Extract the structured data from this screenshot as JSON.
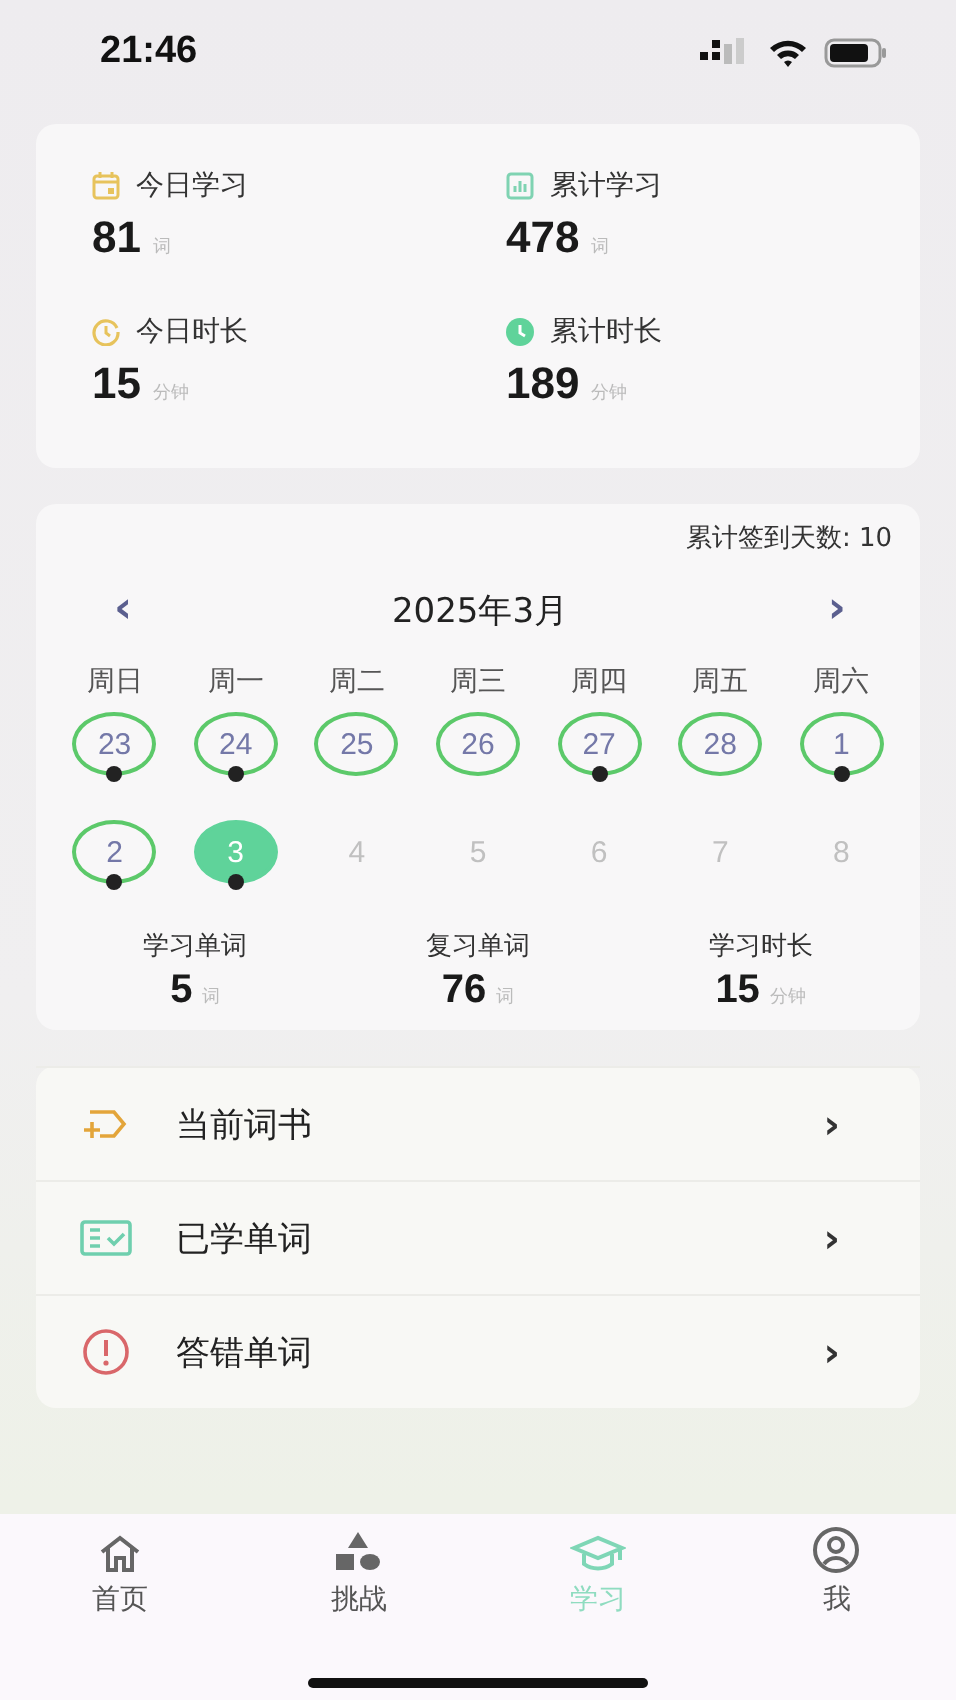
{
  "status_bar": {
    "time": "21:46"
  },
  "stats": [
    {
      "label": "今日学习",
      "value": "81",
      "unit": "词"
    },
    {
      "label": "累计学习",
      "value": "478",
      "unit": "词"
    },
    {
      "label": "今日时长",
      "value": "15",
      "unit": "分钟"
    },
    {
      "label": "累计时长",
      "value": "189",
      "unit": "分钟"
    }
  ],
  "calendar": {
    "total_checkins": "累计签到天数: 10",
    "prev": "‹",
    "month": "2025年3月",
    "next": "›",
    "weekdays": [
      "周日",
      "周一",
      "周二",
      "周三",
      "周四",
      "周五",
      "周六"
    ],
    "days": [
      {
        "label": "23",
        "kind": "signed",
        "dot": true,
        "selected": false
      },
      {
        "label": "24",
        "kind": "signed",
        "dot": true,
        "selected": false
      },
      {
        "label": "25",
        "kind": "signed",
        "dot": false,
        "selected": false
      },
      {
        "label": "26",
        "kind": "signed",
        "dot": false,
        "selected": false
      },
      {
        "label": "27",
        "kind": "signed",
        "dot": true,
        "selected": false
      },
      {
        "label": "28",
        "kind": "signed",
        "dot": false,
        "selected": false
      },
      {
        "label": "1",
        "kind": "signed",
        "dot": true,
        "selected": false
      },
      {
        "label": "2",
        "kind": "signed",
        "dot": true,
        "selected": false
      },
      {
        "label": "3",
        "kind": "signed",
        "dot": true,
        "selected": true
      },
      {
        "label": "4",
        "kind": "future",
        "dot": false,
        "selected": false
      },
      {
        "label": "5",
        "kind": "future",
        "dot": false,
        "selected": false
      },
      {
        "label": "6",
        "kind": "future",
        "dot": false,
        "selected": false
      },
      {
        "label": "7",
        "kind": "future",
        "dot": false,
        "selected": false
      },
      {
        "label": "8",
        "kind": "future",
        "dot": false,
        "selected": false
      }
    ],
    "summary": [
      {
        "label": "学习单词",
        "value": "5",
        "unit": "词"
      },
      {
        "label": "复习单词",
        "value": "76",
        "unit": "词"
      },
      {
        "label": "学习时长",
        "value": "15",
        "unit": "分钟"
      }
    ]
  },
  "menu": [
    {
      "label": "当前词书",
      "chevron": "›"
    },
    {
      "label": "已学单词",
      "chevron": "›"
    },
    {
      "label": "答错单词",
      "chevron": "›"
    }
  ],
  "tabs": [
    {
      "label": "首页",
      "selected": false
    },
    {
      "label": "挑战",
      "selected": false
    },
    {
      "label": "学习",
      "selected": true
    },
    {
      "label": "我",
      "selected": false
    }
  ]
}
